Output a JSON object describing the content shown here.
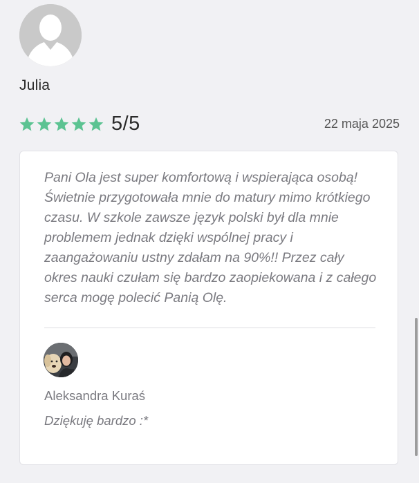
{
  "review": {
    "reviewer_name": "Julia",
    "avatar_icon": "default-user-icon",
    "rating": {
      "stars": 5,
      "max": 5,
      "label": "5/5",
      "star_color": "#5cc392"
    },
    "date": "22 maja 2025",
    "text": "Pani Ola jest super komfortową i wspierająca osobą! Świetnie przygotowała mnie do matury mimo krótkiego czasu. W szkole zawsze język polski był dla mnie problemem jednak dzięki wspólnej pracy i zaangażowaniu ustny zdałam na 90%!! Przez cały okres nauki czułam się bardzo zaopiekowana i z całego serca mogę polecić Panią Olę."
  },
  "reply": {
    "author": "Aleksandra Kuraś",
    "text": "Dziękuję bardzo :*",
    "avatar_icon": "profile-photo"
  }
}
